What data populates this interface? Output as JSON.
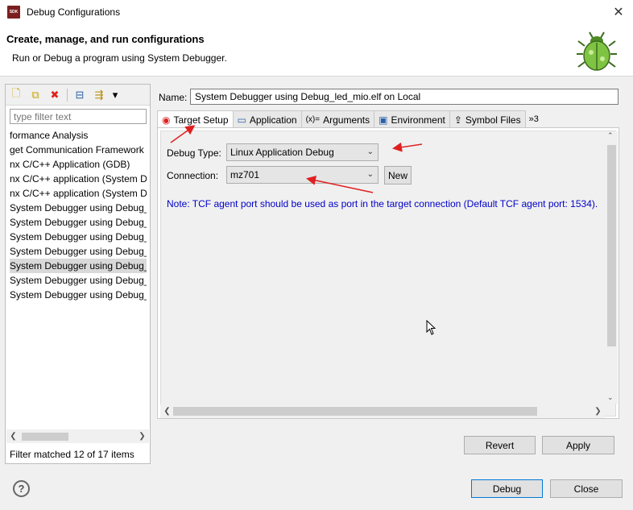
{
  "window": {
    "title": "Debug Configurations",
    "app_icon_text": "SDK",
    "close_glyph": "✕"
  },
  "header": {
    "title": "Create, manage, and run configurations",
    "subtitle": "Run or Debug a program using System Debugger."
  },
  "left": {
    "toolbar": [
      {
        "name": "new-config-icon",
        "glyph": "🗋"
      },
      {
        "name": "duplicate-icon",
        "glyph": "⧉"
      },
      {
        "name": "delete-icon",
        "glyph": "✖"
      },
      {
        "name": "collapse-all-icon",
        "glyph": "⊟"
      },
      {
        "name": "filter-icon",
        "glyph": "⇶"
      },
      {
        "name": "view-menu-icon",
        "glyph": "▾"
      }
    ],
    "filter_placeholder": "type filter text",
    "items": [
      "formance Analysis",
      "get Communication Framework",
      "nx C/C++ Application (GDB)",
      "nx C/C++ application (System D",
      "nx C/C++ application (System D",
      "System Debugger using Debug_",
      "System Debugger using Debug_",
      "System Debugger using Debug_",
      "System Debugger using Debug_",
      "System Debugger using Debug_",
      "System Debugger using Debug_",
      "System Debugger using Debug_"
    ],
    "selected_index": 9,
    "status": "Filter matched 12 of 17 items"
  },
  "right": {
    "name_label": "Name:",
    "name_value": "System Debugger using Debug_led_mio.elf on Local",
    "tabs": [
      {
        "label": "Target Setup",
        "icon": "target-icon",
        "glyph": "◉",
        "color": "#d22"
      },
      {
        "label": "Application",
        "icon": "application-icon",
        "glyph": "▭",
        "color": "#2a5fa8"
      },
      {
        "label": "Arguments",
        "icon": "arguments-icon",
        "glyph": "(x)=",
        "color": "#333"
      },
      {
        "label": "Environment",
        "icon": "environment-icon",
        "glyph": "▣",
        "color": "#2a5fa8"
      },
      {
        "label": "Symbol Files",
        "icon": "symbol-files-icon",
        "glyph": "⇪",
        "color": "#555"
      },
      {
        "label": "»3",
        "icon": "more-tabs-icon",
        "glyph": "",
        "color": "#333"
      }
    ],
    "debug_type_label": "Debug Type:",
    "debug_type_value": "Linux Application Debug",
    "connection_label": "Connection:",
    "connection_value": "mz701",
    "new_label": "New",
    "note": "Note: TCF agent port should be used as port in the target connection (Default TCF agent port: 1534).",
    "revert_label": "Revert",
    "apply_label": "Apply"
  },
  "footer": {
    "debug_label": "Debug",
    "close_label": "Close",
    "help_glyph": "?"
  },
  "colors": {
    "accent": "#0078d7",
    "note_text": "#0000c8",
    "annotation_arrow": "#e02020"
  }
}
